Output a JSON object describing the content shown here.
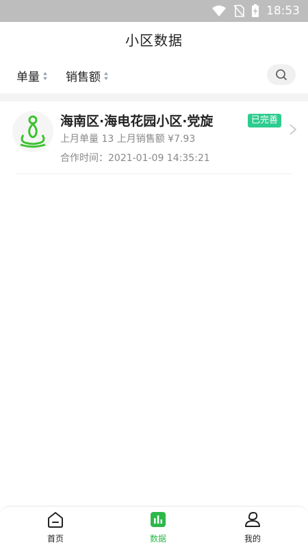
{
  "status_bar": {
    "time": "18:53"
  },
  "header": {
    "title": "小区数据"
  },
  "filters": {
    "sort_quantity": "单量",
    "sort_sales": "销售额"
  },
  "list": {
    "items": [
      {
        "name": "海南区·海电花园小区·党旋",
        "badge": "已完善",
        "stats": "上月单量 13 上月销售额 ¥7.93",
        "time": "合作时间：2021-01-09 14:35:21"
      }
    ]
  },
  "tab_bar": {
    "home": "首页",
    "data": "数据",
    "mine": "我的",
    "active_color": "#2db84a"
  },
  "colors": {
    "badge": "#2ecc8e",
    "accent": "#2db84a"
  }
}
